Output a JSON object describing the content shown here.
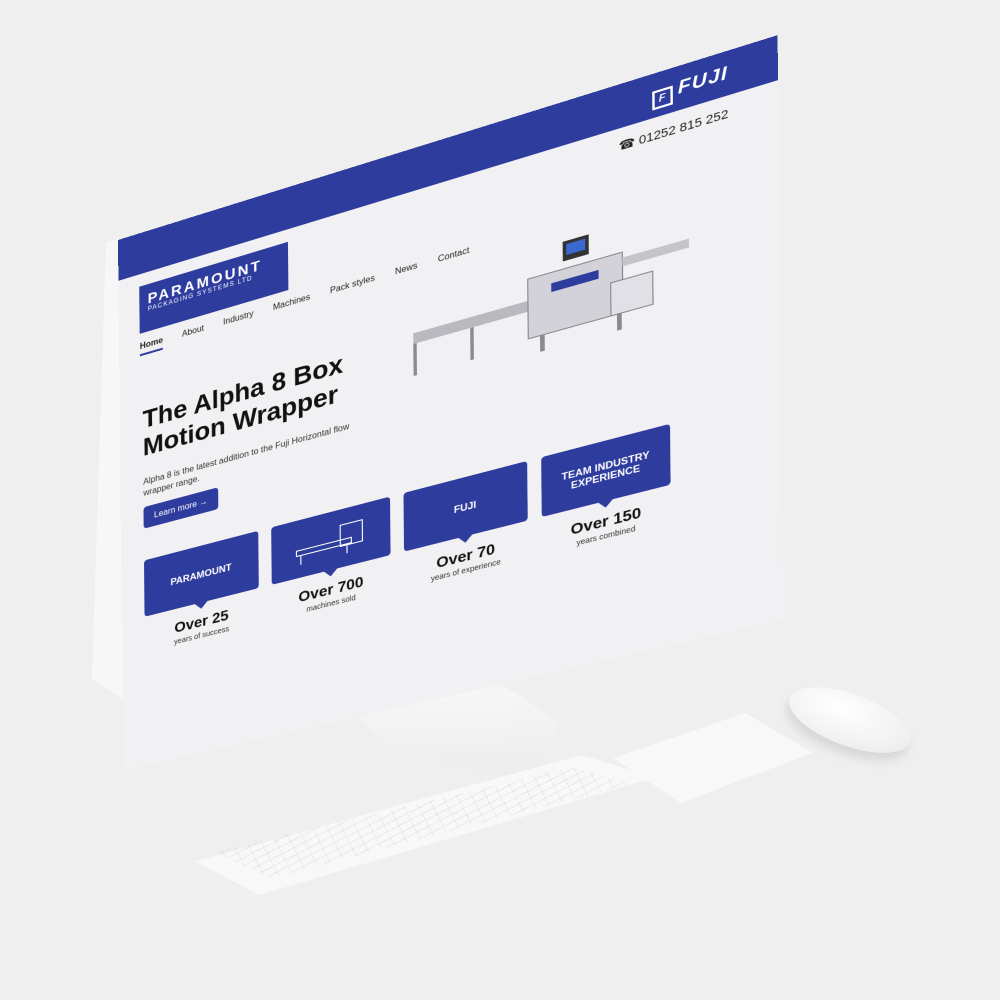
{
  "header": {
    "brand_name": "PARAMOUNT",
    "brand_sub": "PACKAGING SYSTEMS LTD",
    "partner_logo": "FUJI",
    "phone": "01252 815 252"
  },
  "nav": {
    "items": [
      {
        "label": "Home"
      },
      {
        "label": "About"
      },
      {
        "label": "Industry"
      },
      {
        "label": "Machines"
      },
      {
        "label": "Pack styles"
      },
      {
        "label": "News"
      },
      {
        "label": "Contact"
      }
    ]
  },
  "hero": {
    "title_line1": "The Alpha 8 Box",
    "title_line2": "Motion Wrapper",
    "description": "Alpha 8 is the latest addition to the Fuji Horizontal flow wrapper range.",
    "button_label": "Learn more"
  },
  "stats": [
    {
      "card": "PARAMOUNT",
      "value": "Over 25",
      "caption": "years of success"
    },
    {
      "card": "",
      "value": "Over 700",
      "caption": "machines sold"
    },
    {
      "card": "FUJI",
      "value": "Over 70",
      "caption": "years of experience"
    },
    {
      "card": "TEAM INDUSTRY EXPERIENCE",
      "value": "Over 150",
      "caption": "years combined"
    }
  ],
  "colors": {
    "brand": "#2e3c9e",
    "background": "#efefef"
  },
  "icons": {
    "phone": "phone-icon",
    "arrow": "arrow-right-icon"
  }
}
